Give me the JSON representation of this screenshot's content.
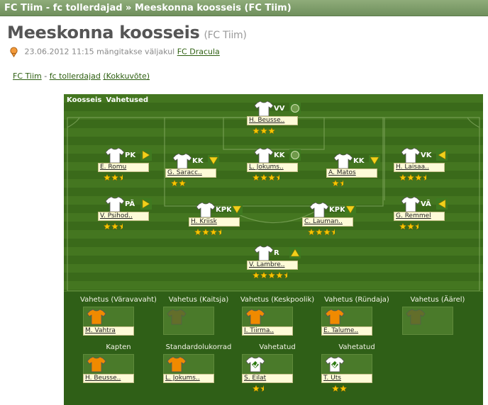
{
  "topbar": {
    "club": "FC Tiim",
    "sep1": " - ",
    "team": "fc tollerdajad",
    "sep2": " » ",
    "page": "Meeskonna koosseis (FC Tiim)"
  },
  "title": {
    "main": "Meeskonna koosseis",
    "sub": "(FC Tiim)"
  },
  "meta": {
    "text": "23.06.2012 11:15 mängitakse väljakul",
    "link": "FC Dracula"
  },
  "crumbs": {
    "club": "FC Tiim",
    "sep": " - ",
    "team": "fc tollerdajad",
    "link": "(Kokkuvõte)"
  },
  "tabs": [
    "Koosseis",
    "Vahetused"
  ],
  "colors": {
    "field": "#3d6d1c",
    "nameplate": "#fefbd8",
    "star": "#f5c400",
    "orange": "#f08a00"
  },
  "players": [
    {
      "pos": "VV",
      "name": "H. Beusse..",
      "stars": 3,
      "marker": "circle"
    },
    {
      "pos": "PK",
      "name": "E. Romu",
      "stars": 2.5,
      "marker": "arrow-right"
    },
    {
      "pos": "KK",
      "name": "G. Saracc..",
      "stars": 2,
      "marker": "arrow-down"
    },
    {
      "pos": "KK",
      "name": "L. Jokums..",
      "stars": 3.5,
      "marker": "circle"
    },
    {
      "pos": "KK",
      "name": "A. Matos",
      "stars": 1.5,
      "marker": "arrow-down"
    },
    {
      "pos": "VK",
      "name": "H. Laisaa..",
      "stars": 3.5,
      "marker": "arrow-left"
    },
    {
      "pos": "PÄ",
      "name": "V. Psihod..",
      "stars": 2.5,
      "marker": "arrow-right"
    },
    {
      "pos": "KPK",
      "name": "H. Kriisk",
      "stars": 3.5,
      "marker": "arrow-down"
    },
    {
      "pos": "KPK",
      "name": "C. Lauman..",
      "stars": 3.5,
      "marker": "arrow-down"
    },
    {
      "pos": "VÄ",
      "name": "G. Remmel",
      "stars": 2.5,
      "marker": "arrow-left"
    },
    {
      "pos": "R",
      "name": "V. Lambre..",
      "stars": 4.5,
      "marker": "arrow-up"
    }
  ],
  "subs": [
    {
      "label": "Vahetus (Väravavaht)",
      "name": "M. Vahtra",
      "stars": 0,
      "shirt": "orange"
    },
    {
      "label": "Vahetus (Kaitsja)",
      "name": "",
      "stars": 0,
      "shirt": "empty"
    },
    {
      "label": "Vahetus (Keskpoolik)",
      "name": "I. Tiirma..",
      "stars": 0,
      "shirt": "orange"
    },
    {
      "label": "Vahetus (Ründaja)",
      "name": "E. Talume..",
      "stars": 0,
      "shirt": "orange"
    },
    {
      "label": "Vahetus (Äärel)",
      "name": "",
      "stars": 0,
      "shirt": "empty"
    },
    {
      "label": "Kapten",
      "name": "H. Beusse..",
      "stars": 0,
      "shirt": "orange"
    },
    {
      "label": "Standardolukorrad",
      "name": "L. Jokums..",
      "stars": 0,
      "shirt": "orange"
    },
    {
      "label": "Vahetatud",
      "name": "S. Eilat",
      "stars": 1.5,
      "shirt": "swap"
    },
    {
      "label": "Vahetatud",
      "name": "T. Uts",
      "stars": 2,
      "shirt": "swap"
    }
  ]
}
